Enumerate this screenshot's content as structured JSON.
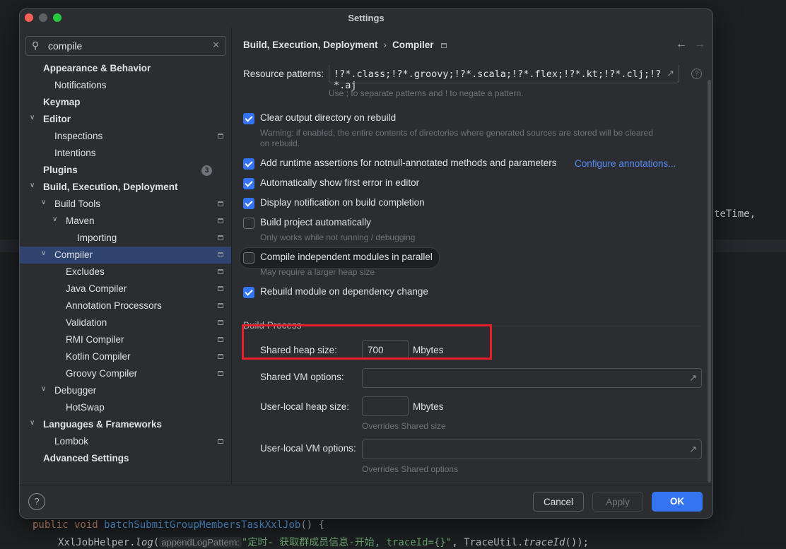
{
  "window": {
    "title": "Settings"
  },
  "search": {
    "value": "compile"
  },
  "tree": [
    {
      "label": "Appearance & Behavior",
      "bold": true,
      "expand": "",
      "has_pin": false
    },
    {
      "label": "Notifications",
      "bold": false,
      "expand": "",
      "has_pin": false
    },
    {
      "label": "Keymap",
      "bold": true,
      "expand": "",
      "has_pin": false
    },
    {
      "label": "Editor",
      "bold": true,
      "expand": "expanded",
      "has_pin": false
    },
    {
      "label": "Inspections",
      "bold": false,
      "expand": "",
      "has_pin": true
    },
    {
      "label": "Intentions",
      "bold": false,
      "expand": "",
      "has_pin": false
    },
    {
      "label": "Plugins",
      "bold": true,
      "expand": "",
      "has_pin": false,
      "badge": "3"
    },
    {
      "label": "Build, Execution, Deployment",
      "bold": true,
      "expand": "expanded",
      "has_pin": false
    },
    {
      "label": "Build Tools",
      "bold": false,
      "expand": "expanded",
      "has_pin": true
    },
    {
      "label": "Maven",
      "bold": false,
      "expand": "expanded",
      "has_pin": true
    },
    {
      "label": "Importing",
      "bold": false,
      "expand": "",
      "has_pin": true
    },
    {
      "label": "Compiler",
      "bold": false,
      "expand": "expanded",
      "has_pin": true,
      "selected": true
    },
    {
      "label": "Excludes",
      "bold": false,
      "expand": "",
      "has_pin": true
    },
    {
      "label": "Java Compiler",
      "bold": false,
      "expand": "",
      "has_pin": true
    },
    {
      "label": "Annotation Processors",
      "bold": false,
      "expand": "",
      "has_pin": true
    },
    {
      "label": "Validation",
      "bold": false,
      "expand": "",
      "has_pin": true
    },
    {
      "label": "RMI Compiler",
      "bold": false,
      "expand": "",
      "has_pin": true
    },
    {
      "label": "Kotlin Compiler",
      "bold": false,
      "expand": "",
      "has_pin": true
    },
    {
      "label": "Groovy Compiler",
      "bold": false,
      "expand": "",
      "has_pin": true
    },
    {
      "label": "Debugger",
      "bold": false,
      "expand": "expanded",
      "has_pin": false
    },
    {
      "label": "HotSwap",
      "bold": false,
      "expand": "",
      "has_pin": false
    },
    {
      "label": "Languages & Frameworks",
      "bold": true,
      "expand": "expanded",
      "has_pin": false
    },
    {
      "label": "Lombok",
      "bold": false,
      "expand": "",
      "has_pin": true
    },
    {
      "label": "Advanced Settings",
      "bold": true,
      "expand": "",
      "has_pin": false
    }
  ],
  "breadcrumb": {
    "parent": "Build, Execution, Deployment",
    "separator": "›",
    "current": "Compiler"
  },
  "nav": {
    "back": "←",
    "forward": "→"
  },
  "compiler": {
    "resource_patterns_label": "Resource patterns:",
    "resource_patterns_value": "!?*.class;!?*.groovy;!?*.scala;!?*.flex;!?*.kt;!?*.clj;!?*.aj",
    "resource_patterns_hint": "Use ; to separate patterns and ! to negate a pattern.",
    "options": [
      {
        "label": "Clear output directory on rebuild",
        "checked": true,
        "hint": "Warning: if enabled, the entire contents of directories where generated sources are stored will be cleared on rebuild."
      },
      {
        "label": "Add runtime assertions for notnull-annotated methods and parameters",
        "checked": true,
        "link": "Configure annotations..."
      },
      {
        "label": "Automatically show first error in editor",
        "checked": true
      },
      {
        "label": "Display notification on build completion",
        "checked": true
      },
      {
        "label": "Build project automatically",
        "checked": false,
        "hint": "Only works while not running / debugging"
      },
      {
        "label": "Compile independent modules in parallel",
        "checked": false,
        "hint": "May require a larger heap size"
      },
      {
        "label": "Rebuild module on dependency change",
        "checked": true
      }
    ]
  },
  "build_process": {
    "section_title": "Build Process",
    "shared_heap_label": "Shared heap size:",
    "shared_heap_value": "700",
    "shared_heap_unit": "Mbytes",
    "shared_vm_label": "Shared VM options:",
    "shared_vm_value": "",
    "user_heap_label": "User-local heap size:",
    "user_heap_value": "",
    "user_heap_unit": "Mbytes",
    "user_heap_hint": "Overrides Shared size",
    "user_vm_label": "User-local VM options:",
    "user_vm_value": "",
    "user_vm_hint": "Overrides Shared options"
  },
  "footer": {
    "help": "?",
    "cancel": "Cancel",
    "apply": "Apply",
    "ok": "OK"
  },
  "editor_bg": {
    "line1_kw": "public void ",
    "line1_fn": "batchSubmitGroupMembersTaskXxlJob",
    "line1_rest": "() {",
    "line2_a": "XxlJobHelper.",
    "line2_log": "log",
    "line2_hint": "appendLogPattern:",
    "line2_str": "\"定时- 获取群成员信息-开始, traceId={}\"",
    "line2_b": ", TraceUtil.",
    "line2_tid": "traceId",
    "line2_c": "());",
    "right_text": "teTime,"
  },
  "colors": {
    "accent": "#3574f0",
    "link": "#548af7",
    "highlight_box": "#e5202a",
    "selection": "#2e436e"
  }
}
